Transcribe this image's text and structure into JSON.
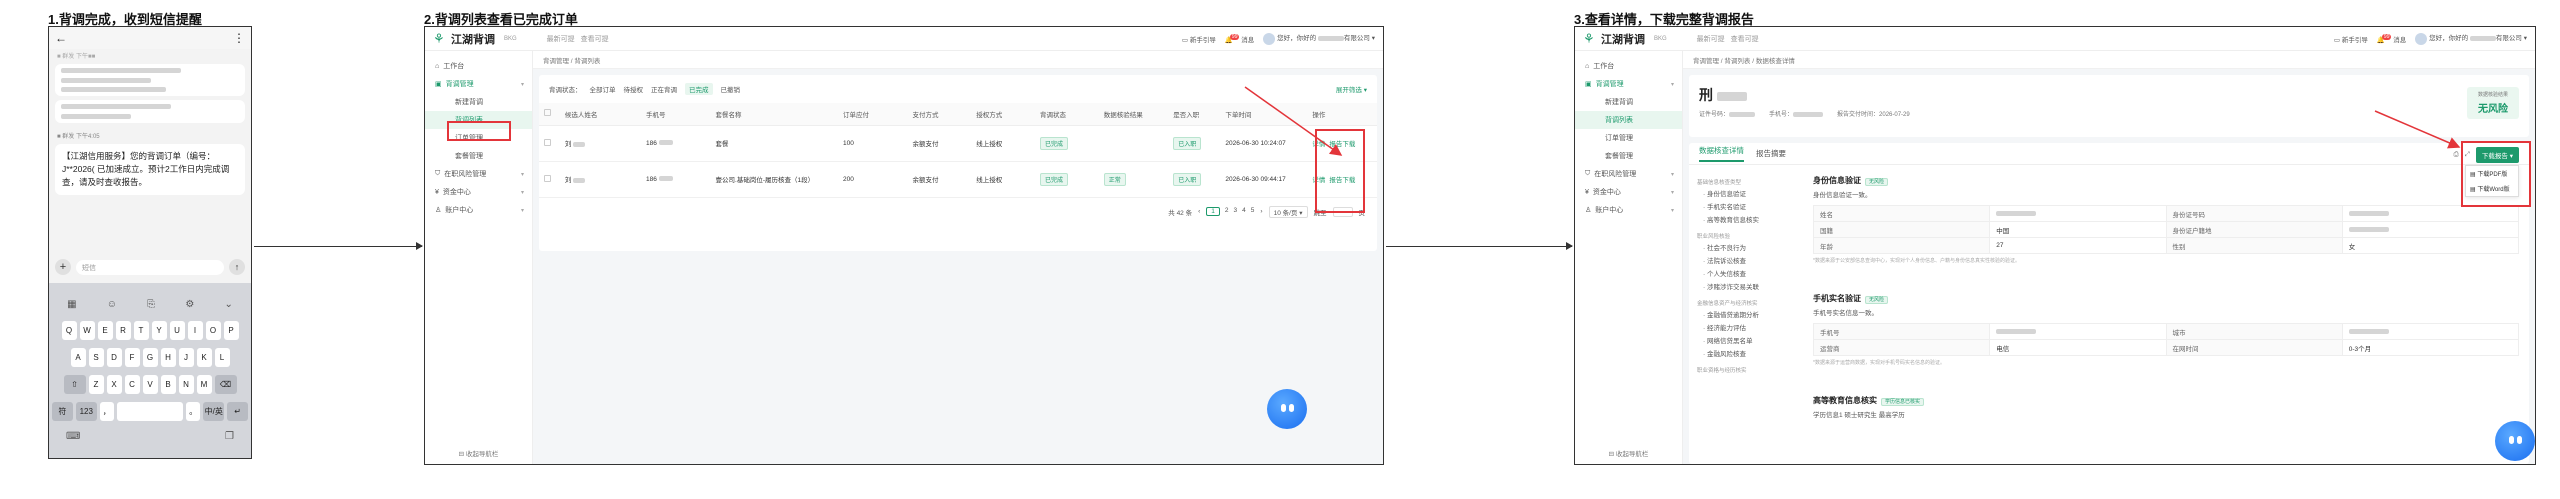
{
  "steps": {
    "s1": "1.背调完成，收到短信提醒",
    "s2": "2.背调列表查看已完成订单",
    "s3": "3.查看详情，下载完整背调报告"
  },
  "phone": {
    "back": "←",
    "more": "⋮",
    "sub_line": "■ 群发 下午■■",
    "time2": "■ 群发 下午4:05",
    "msg": "【江湖信用服务】您的背调订单（编号：J**2026( 已加速成立。预计2工作日内完成调查，请及时查收报告。",
    "input_placeholder": "短信",
    "keys_row1": [
      "Q",
      "W",
      "E",
      "R",
      "T",
      "Y",
      "U",
      "I",
      "O",
      "P"
    ],
    "keys_row2": [
      "A",
      "S",
      "D",
      "F",
      "G",
      "H",
      "J",
      "K",
      "L"
    ],
    "keys_row3": [
      "Z",
      "X",
      "C",
      "V",
      "B",
      "N",
      "M"
    ],
    "key_shift": "⇧",
    "key_del": "⌫",
    "key_fn": "符",
    "key_num": "123",
    "key_comma": "，",
    "key_dot": "。",
    "key_lang": "中/英",
    "key_enter": "↵"
  },
  "app": {
    "logo": "江湖背调",
    "logo_sub": "BKG",
    "head_links": [
      "最新可提",
      "查看可提"
    ],
    "head_right": [
      "新手引导",
      "消息",
      "您好，你好的",
      "有限公司"
    ],
    "badge": "99",
    "side": [
      {
        "label": "工作台",
        "type": "top"
      },
      {
        "label": "背调管理",
        "type": "group"
      },
      {
        "label": "新建背调",
        "type": "sub"
      },
      {
        "label": "背调列表",
        "type": "sub"
      },
      {
        "label": "订单管理",
        "type": "sub"
      },
      {
        "label": "套餐管理",
        "type": "sub"
      },
      {
        "label": "在职风险管理",
        "type": "top"
      },
      {
        "label": "资金中心",
        "type": "top"
      },
      {
        "label": "账户中心",
        "type": "top"
      }
    ],
    "side_foot": "收起导航栏"
  },
  "list": {
    "crumb": "背调管理 / 背调列表",
    "filter_label": "背调状态：",
    "filters": [
      "全部订单",
      "待授权",
      "正在背调",
      "已完成",
      "已撤销"
    ],
    "expand": "展开筛选",
    "columns": [
      "",
      "候选人姓名",
      "手机号",
      "套餐名称",
      "订单应付",
      "支付方式",
      "授权方式",
      "背调状态",
      "数据核验结果",
      "是否入职",
      "下单时间",
      "操作"
    ],
    "rows": [
      {
        "name": "刘",
        "phone": "186",
        "pkg": "套餐",
        "price": "100",
        "pay": "余额支付",
        "auth": "线上授权",
        "status": "已完成",
        "result": "",
        "hired": "已入职",
        "time": "2026-06-30 10:24:07",
        "ops": [
          "详情",
          "报告下载"
        ]
      },
      {
        "name": "刘",
        "phone": "186",
        "pkg": "壹公司.基础岗位-履历核查（1段）",
        "price": "200",
        "pay": "余额支付",
        "auth": "线上授权",
        "status": "已完成",
        "result": "正常",
        "hired": "已入职",
        "time": "2026-06-30 09:44:17",
        "ops": [
          "详情",
          "报告下载"
        ]
      }
    ],
    "pager": {
      "total": "共 42 条",
      "pages": [
        "1",
        "2",
        "3",
        "4",
        "5"
      ],
      "size": "10 条/页",
      "jump": "跳至",
      "page_unit": "页"
    }
  },
  "detail": {
    "crumb": "背调管理 / 背调列表 / 数据核查详情",
    "name": "刑",
    "meta": [
      "证件号码：",
      "手机号：",
      "报告交付时间：2026-07-29"
    ],
    "risk_label": "数据核验结果",
    "risk_value": "无风险",
    "tabs": [
      "数据核查详情",
      "报告摘要"
    ],
    "download_btn": "下载报告 ▾",
    "download_menu": [
      "下载PDF版",
      "下载Word版"
    ],
    "toc": [
      {
        "g": "基础信息核查类型"
      },
      {
        "i": "身份信息验证"
      },
      {
        "i": "手机实名验证"
      },
      {
        "i": "高等教育信息核实"
      },
      {
        "g": "职业风险核验"
      },
      {
        "i": "社会不良行为"
      },
      {
        "i": "法院诉讼核查"
      },
      {
        "i": "个人失信核查"
      },
      {
        "i": "涉赌涉诈交易关联"
      },
      {
        "g": "金融信息资产与经济核实"
      },
      {
        "i": "金融借贷逾期分析"
      },
      {
        "i": "经济能力评估"
      },
      {
        "i": "网络信贷黑名单"
      },
      {
        "i": "金融风险核查"
      },
      {
        "g": "职业资格与经历核实"
      }
    ],
    "sec1": {
      "title": "身份信息验证",
      "pill": "无风险",
      "desc": "身份信息验证一致。",
      "rows": [
        [
          "姓名",
          "",
          "身份证号码",
          ""
        ],
        [
          "国籍",
          "中国",
          "身份证户籍地",
          ""
        ],
        [
          "年龄",
          "27",
          "性别",
          "女"
        ]
      ],
      "note": "*数据来源于公安部信息查询中心，实现对个人身份信息、户籍与身份信息真实性核验的验证。"
    },
    "sec2": {
      "title": "手机实名验证",
      "pill": "无风险",
      "desc": "手机号实名信息一致。",
      "rows": [
        [
          "手机号",
          "",
          "城市",
          ""
        ],
        [
          "运营商",
          "电信",
          "在网时间",
          "0-3个月"
        ]
      ],
      "note": "*数据来源于运营商数据，实现对手机号码实名信息的验证。"
    },
    "sec3": {
      "title": "高等教育信息核实",
      "pill": "学历信息已核实",
      "line": "学历信息1 硕士研究生 最高学历"
    }
  }
}
